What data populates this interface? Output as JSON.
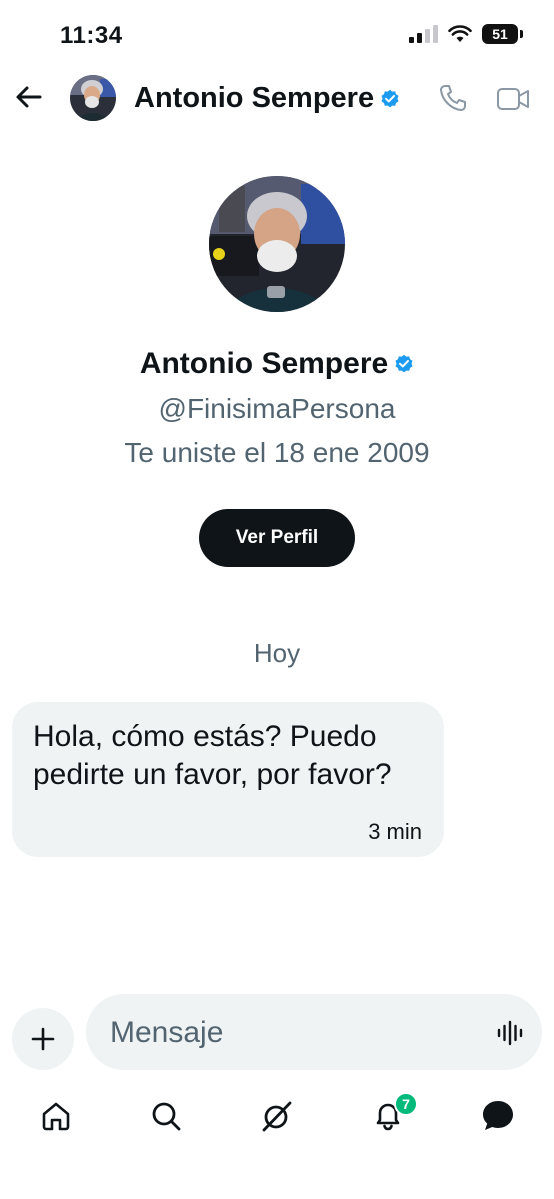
{
  "status_bar": {
    "time": "11:34",
    "battery": "51"
  },
  "header": {
    "name": "Antonio Sempere"
  },
  "profile": {
    "name": "Antonio Sempere",
    "handle": "@FinisimaPersona",
    "joined": "Te uniste el 18 ene 2009",
    "view_profile_label": "Ver Perfil"
  },
  "conversation": {
    "day_label": "Hoy",
    "messages": [
      {
        "text": "Hola, cómo estás? Puedo pedirte un favor, por favor?",
        "time": "3 min"
      }
    ]
  },
  "composer": {
    "placeholder": "Mensaje"
  },
  "nav": {
    "notifications_count": "7",
    "items": [
      "home-icon",
      "search-icon",
      "grok-icon",
      "bell-icon",
      "messages-icon"
    ]
  },
  "colors": {
    "verified": "#1d9bf0",
    "badge": "#00ba7c",
    "button_bg": "#0f1419",
    "bubble_bg": "#eff3f4",
    "secondary_text": "#536471"
  }
}
